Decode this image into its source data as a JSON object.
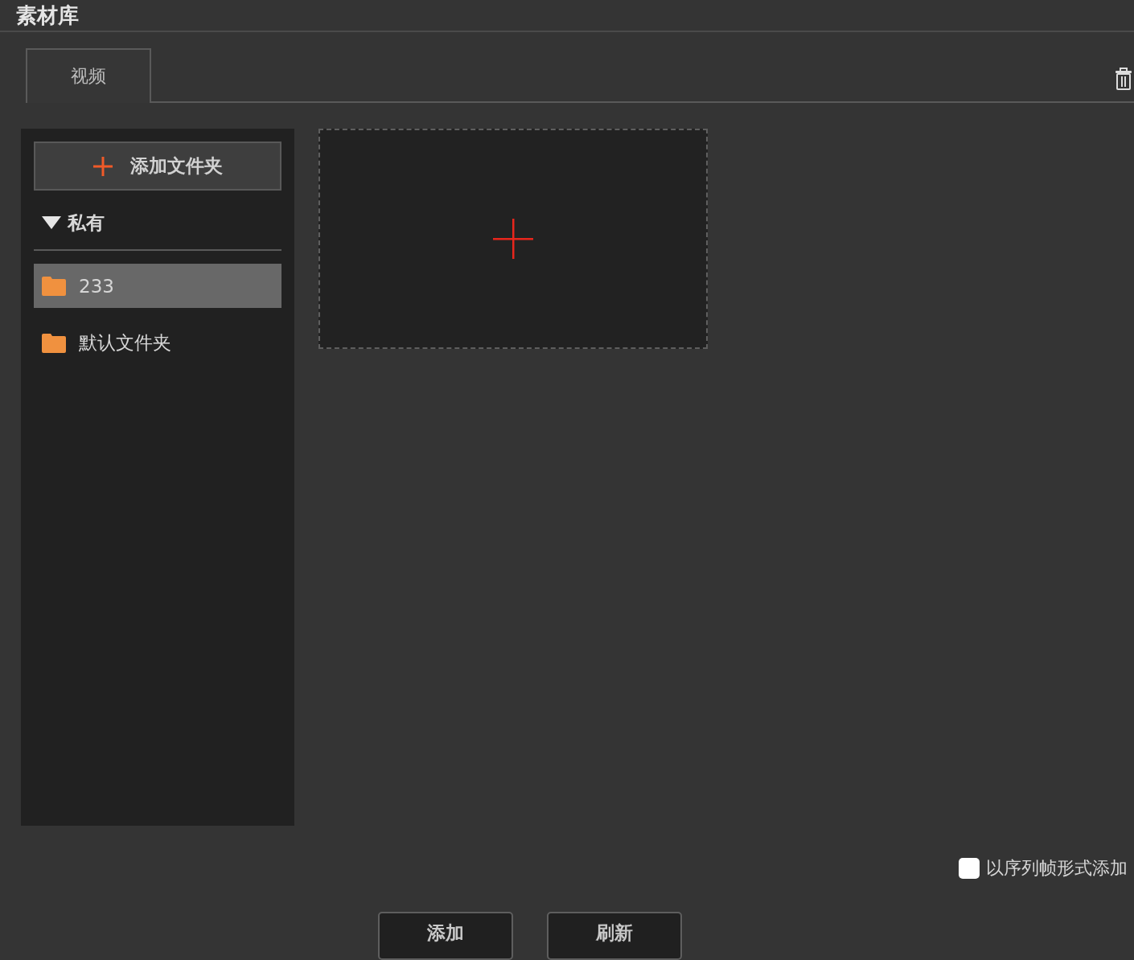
{
  "window": {
    "title": "素材库"
  },
  "tabs": [
    {
      "label": "视频",
      "selected": true
    }
  ],
  "sidebar": {
    "add_folder_button": {
      "label": "添加文件夹"
    },
    "section": {
      "label": "私有",
      "expanded": true,
      "folders": [
        {
          "name": "233",
          "selected": true
        },
        {
          "name": "默认文件夹",
          "selected": false
        }
      ]
    }
  },
  "sequence_checkbox": {
    "label": "以序列帧形式添加",
    "checked": false
  },
  "buttons": [
    "添加",
    "刷新"
  ]
}
